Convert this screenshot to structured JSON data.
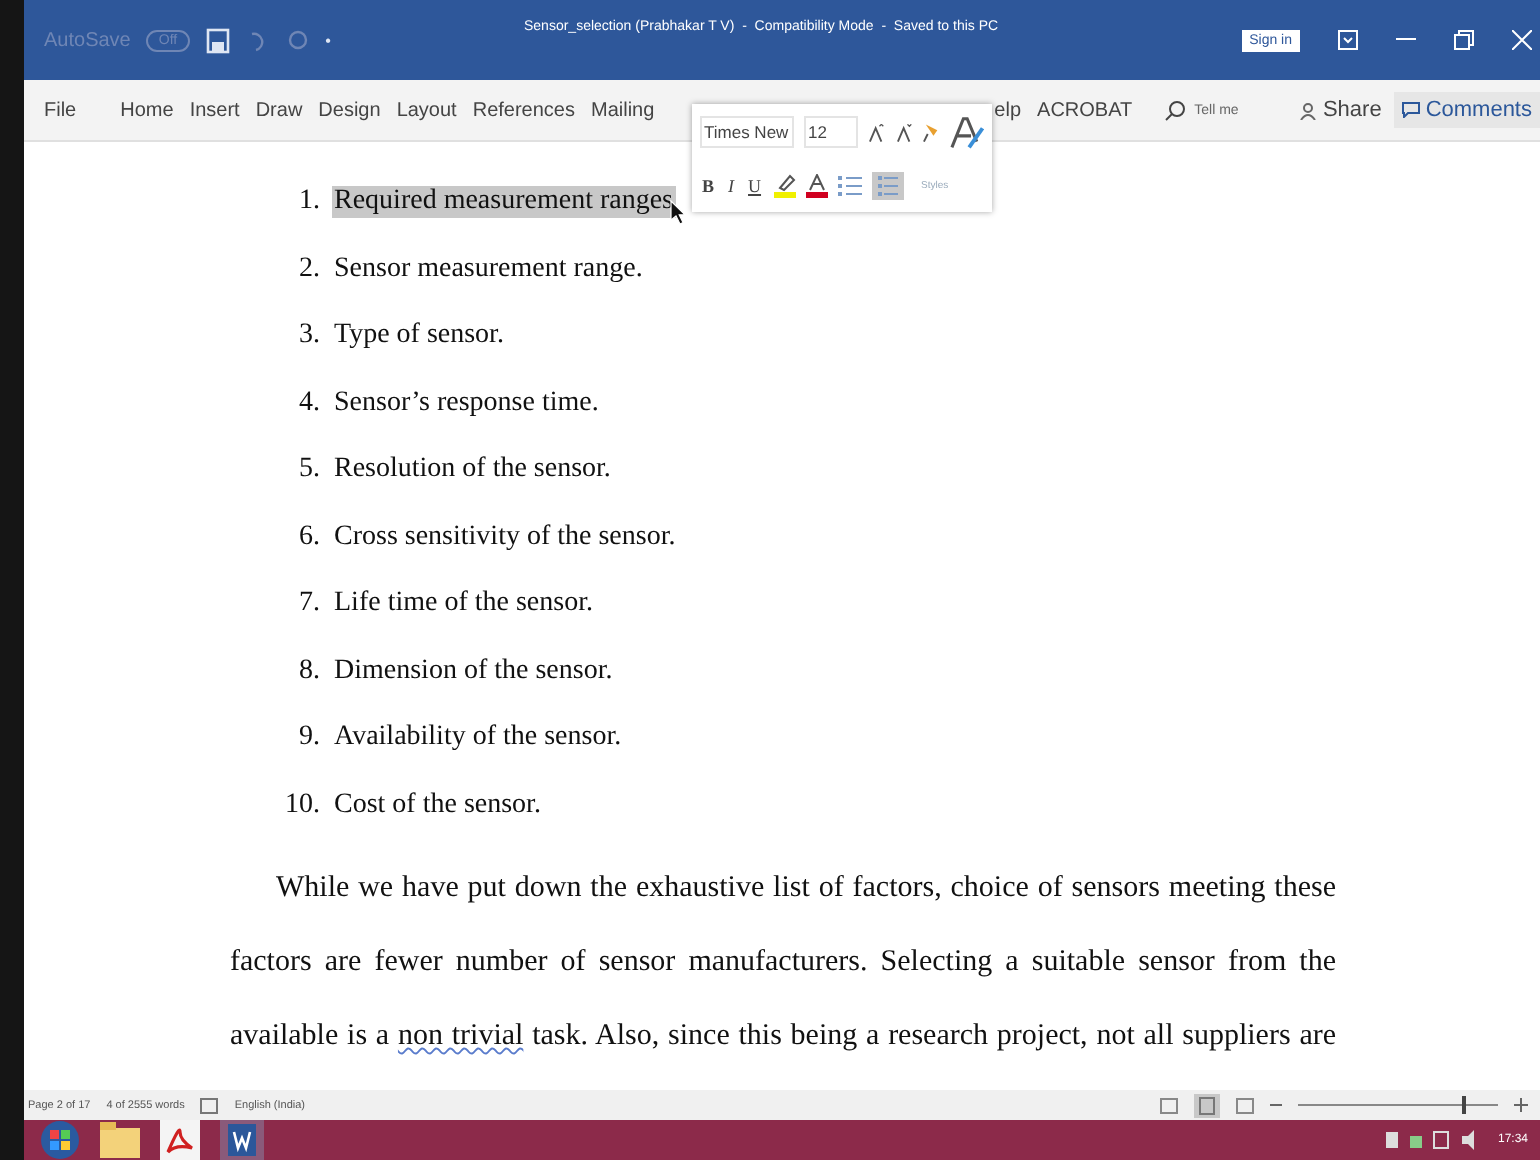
{
  "title_bar": {
    "autosave_label": "AutoSave",
    "autosave_state": "Off",
    "customize": "•",
    "title": "Sensor_selection (Prabhakar T V)  -  Compatibility Mode  -  Saved to this PC",
    "sign_in": "Sign in"
  },
  "menu": {
    "tabs": [
      {
        "label": "File",
        "selected": false
      },
      {
        "label": "Home",
        "selected": false
      },
      {
        "label": "Insert",
        "selected": false
      },
      {
        "label": "Draw",
        "selected": false
      },
      {
        "label": "Design",
        "selected": false
      },
      {
        "label": "Layout",
        "selected": false
      },
      {
        "label": "References",
        "selected": false
      },
      {
        "label": "Mailing",
        "selected": false
      }
    ],
    "tabs_after": [
      {
        "label": "elp",
        "selected": false
      },
      {
        "label": "ACROBAT",
        "selected": false
      }
    ],
    "tell_me": "Tell me",
    "share": "Share",
    "comments": "Comments"
  },
  "mini_toolbar": {
    "font": "Times New",
    "size": "12",
    "bold": "B",
    "italic": "I",
    "underline": "U",
    "styles": "Styles",
    "numbering_selected": true
  },
  "document": {
    "list": [
      {
        "number": "1.",
        "text": "Required measurement ranges",
        "selected": true
      },
      {
        "number": "2.",
        "text": "Sensor measurement range.",
        "selected": false
      },
      {
        "number": "3.",
        "text": "Type of sensor.",
        "selected": false
      },
      {
        "number": "4.",
        "text": "Sensor’s response time.",
        "selected": false
      },
      {
        "number": "5.",
        "text": "Resolution of the sensor.",
        "selected": false
      },
      {
        "number": "6.",
        "text": "Cross sensitivity of the sensor.",
        "selected": false
      },
      {
        "number": "7.",
        "text": "Life time of the sensor.",
        "selected": false
      },
      {
        "number": "8.",
        "text": "Dimension of the sensor.",
        "selected": false
      },
      {
        "number": "9.",
        "text": "Availability of the sensor.",
        "selected": false
      },
      {
        "number": "10.",
        "text": "Cost of the sensor.",
        "selected": false
      }
    ],
    "paragraph_lines": [
      {
        "before": "While we have put down the exhaustive list of factors, choice of sensors meeting these"
      },
      {
        "before": "factors are fewer number of sensor manufacturers. Selecting a suitable sensor from the"
      },
      {
        "before": "available is a ",
        "flagged": "non  trivial",
        "after": " task.  Also, since this being a research project, not all suppliers are"
      }
    ]
  },
  "status_bar": {
    "page": "Page 2 of 17",
    "words": "4 of 2555 words",
    "language": "English (India)",
    "zoom": {
      "level": 0.82
    }
  },
  "taskbar": {
    "time": "17:34"
  }
}
